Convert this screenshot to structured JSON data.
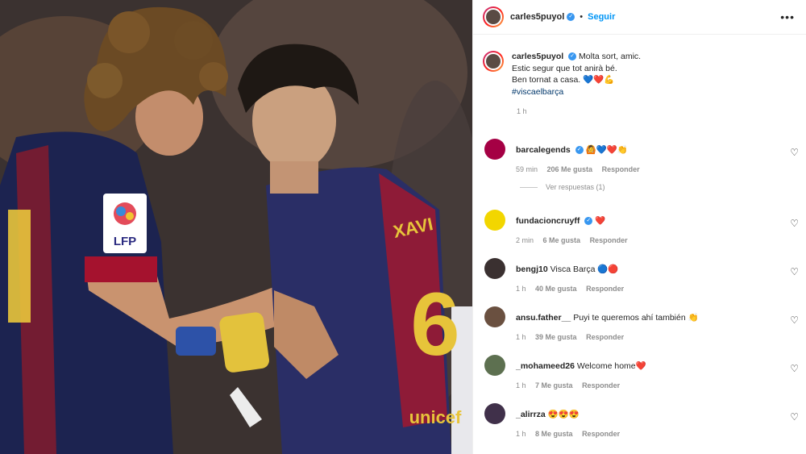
{
  "post": {
    "username": "carles5puyol",
    "follow_label": "Seguir",
    "more_label": "•••",
    "caption_lines": [
      "Molta sort, amic.",
      "Estic segur que tot anirà bé.",
      "Ben tornat a casa. 💙❤️💪"
    ],
    "hashtag": "#viscaelbarça",
    "time": "1 h",
    "photo_texts": {
      "xavi_name": "XAVI",
      "xavi_number": "6",
      "lfp": "LFP",
      "sponsor": "unicef"
    }
  },
  "comments": [
    {
      "user": "barcalegends",
      "verified": true,
      "text": "🙆💙❤️👏",
      "time": "59 min",
      "likes": "206 Me gusta",
      "reply": "Responder",
      "avatar_color": "#a50044"
    },
    {
      "user": "fundacioncruyff",
      "verified": true,
      "text": "❤️",
      "time": "2 min",
      "likes": "6 Me gusta",
      "reply": "Responder",
      "avatar_color": "#f2d600"
    },
    {
      "user": "bengj10",
      "verified": false,
      "text": "Visca Barça 🔵🔴",
      "time": "1 h",
      "likes": "40 Me gusta",
      "reply": "Responder",
      "avatar_color": "#3a3030"
    },
    {
      "user": "ansu.father__",
      "verified": false,
      "text": "Puyi te queremos ahí también 👏",
      "time": "1 h",
      "likes": "39 Me gusta",
      "reply": "Responder",
      "avatar_color": "#6a5040"
    },
    {
      "user": "_mohameed26",
      "verified": false,
      "text": "Welcome home❤️",
      "time": "1 h",
      "likes": "7 Me gusta",
      "reply": "Responder",
      "avatar_color": "#5d7050"
    },
    {
      "user": "_alirrza",
      "verified": false,
      "text": "😍😍😍",
      "time": "1 h",
      "likes": "8 Me gusta",
      "reply": "Responder",
      "avatar_color": "#40304a"
    }
  ],
  "view_replies": "Ver respuestas (1)",
  "icons": {
    "verified": "verified-badge-icon",
    "like": "heart-outline-icon",
    "more": "more-options-icon"
  },
  "colors": {
    "link": "#0095f6",
    "verified": "#3897f0",
    "text": "#262626",
    "muted": "#8e8e8e"
  }
}
